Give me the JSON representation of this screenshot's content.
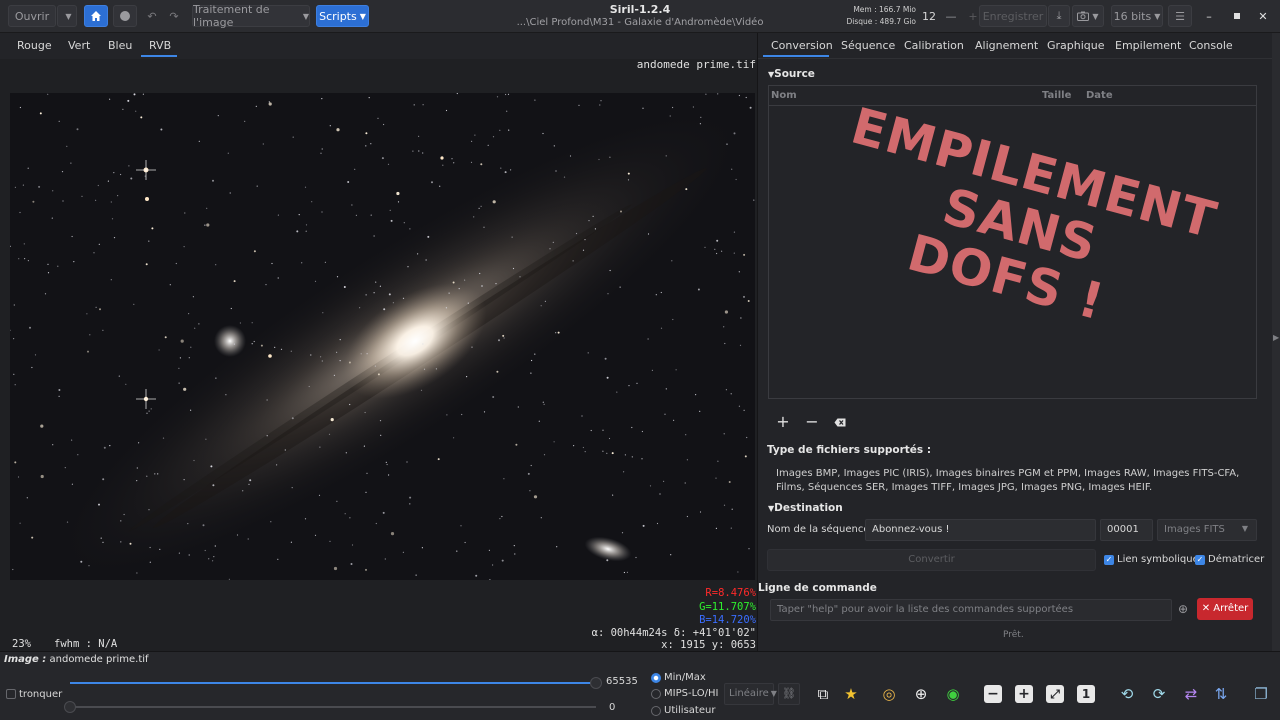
{
  "header": {
    "open": "Ouvrir",
    "image_processing": "Traitement de l'image",
    "scripts": "Scripts",
    "app_title": "Siril-1.2.4",
    "path": "...\\Ciel Profond\\M31 - Galaxie d'Andromède\\Vidéo",
    "mem": "Mem : 166.7 Mio",
    "disk": "Disque : 489.7 Gio",
    "threads": "12",
    "save": "Enregistrer",
    "bits": "16 bits"
  },
  "channels": {
    "tabs": [
      "Rouge",
      "Vert",
      "Bleu",
      "RVB"
    ],
    "active": "RVB"
  },
  "viewer": {
    "filename": "andomede prime.tif",
    "r": "R=8.476%",
    "g": "G=11.707%",
    "b": "B=14.720%",
    "radec": "α: 00h44m24s δ: +41°01'02\"",
    "xy": "x: 1915 y: 0653",
    "zoom": "23%",
    "fwhm": "fwhm : N/A"
  },
  "right_panel": {
    "tabs": [
      "Conversion",
      "Séquence",
      "Calibration",
      "Alignement",
      "Graphique",
      "Empilement",
      "Console"
    ],
    "active_tab": "Conversion",
    "source_title": "Source",
    "columns": [
      "Nom",
      "Taille",
      "Date"
    ],
    "overlay_line1": "EMPILEMENT SANS",
    "overlay_line2": "DOFS !",
    "types_title": "Type de fichiers supportés :",
    "types_text": "Images BMP, Images PIC (IRIS), Images binaires PGM et PPM, Images RAW, Images FITS-CFA, Films, Séquences SER, Images TIFF, Images JPG, Images PNG, Images HEIF.",
    "destination_title": "Destination",
    "seq_name_label": "Nom de la séquence :",
    "seq_name_value": "Abonnez-vous !",
    "seq_index": "00001",
    "format": "Images FITS",
    "convert": "Convertir",
    "symlink": "Lien symbolique",
    "debayer": "Dématricer",
    "cmd_title": "Ligne de commande",
    "cmd_placeholder": "Taper \"help\" pour avoir la liste des commandes supportées",
    "stop": "Arrêter",
    "status": "Prêt."
  },
  "bottom": {
    "image_label": "Image :",
    "image_name": "andomede prime.tif",
    "tronquer": "tronquer",
    "hi_value": "65535",
    "lo_value": "0",
    "hi_fraction": 1.0,
    "lo_fraction": 0.0,
    "modes": [
      "Min/Max",
      "MIPS-LO/HI",
      "Utilisateur"
    ],
    "selected_mode": "Min/Max",
    "stretch": "Linéaire"
  },
  "colors": {
    "accent": "#3d86e6",
    "danger": "#c8282e",
    "overlay": "#d16a6d"
  }
}
